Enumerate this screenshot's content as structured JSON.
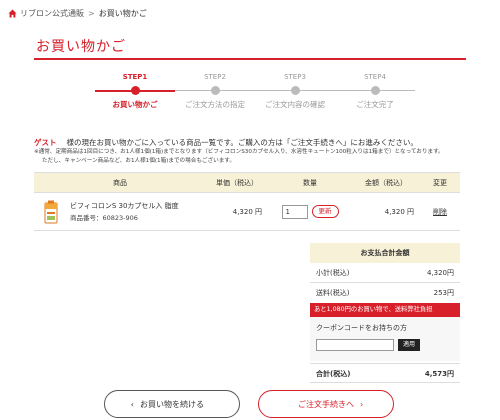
{
  "breadcrumb": {
    "home": "リブロン公式通販",
    "separator": ">",
    "current": "お買い物かご"
  },
  "page_title": "お買い物かご",
  "steps": [
    {
      "num": "STEP1",
      "label": "お買い物かご",
      "active": true
    },
    {
      "num": "STEP2",
      "label": "ご注文方法の指定",
      "active": false
    },
    {
      "num": "STEP3",
      "label": "ご注文内容の確認",
      "active": false
    },
    {
      "num": "STEP4",
      "label": "ご注文完了",
      "active": false
    }
  ],
  "notice": {
    "guest": "ゲスト",
    "main": "様の現在お買い物かごに入っている商品一覧です。ご購入の方は「ご注文手続きへ」にお進みください。",
    "note1": "※通常、定期商品は1回目につき、お1人様1個(1箱)までとなります（ビフィコロンS30カプセル入り、水溶性キュートン100粒入りは1箱まで）となっております。",
    "note2": "ただし、キャンペーン商品など、お1人様1個(1箱)までの場合もございます。"
  },
  "table": {
    "headers": [
      "商品",
      "単価（税込）",
      "数量",
      "金額（税込）",
      "変更"
    ],
    "rows": [
      {
        "name": "ビフィコロンS 30カプセル入 脂度",
        "code": "商品番号：60823-906",
        "unit_price": "4,320 円",
        "quantity": "1",
        "update_label": "更新",
        "amount": "4,320 円",
        "delete_label": "削除"
      }
    ]
  },
  "summary": {
    "title": "お支払合計金額",
    "subtotal_label": "小計(税込)",
    "subtotal_value": "4,320円",
    "shipping_label": "送料(税込)",
    "shipping_value": "253円",
    "alert": "あと1,080円のお買い物で、送料弊社負担",
    "coupon_label": "クーポンコードをお持ちの方",
    "coupon_button": "適用",
    "total_label": "合計(税込)",
    "total_value": "4,573円"
  },
  "buttons": {
    "back": "お買い物を続ける",
    "next": "ご注文手続きへ"
  },
  "colors": {
    "accent": "#d7202a",
    "header_bg": "#f7f2d7"
  }
}
